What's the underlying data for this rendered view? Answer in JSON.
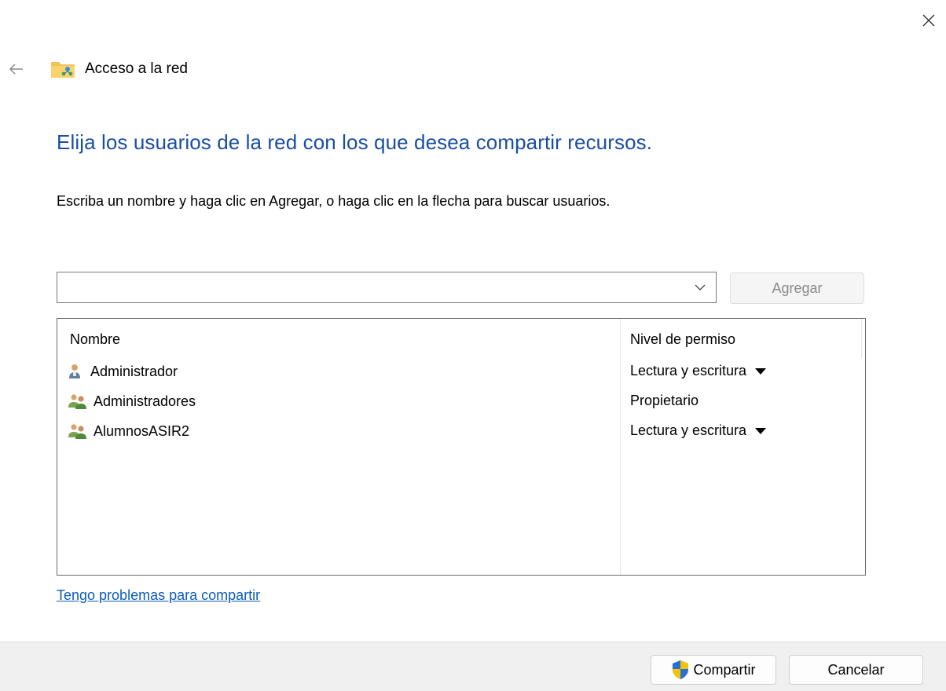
{
  "window": {
    "title": "Acceso a la red",
    "close_icon": "close-icon",
    "back_icon": "back-arrow-icon",
    "folder_icon": "network-folder-icon"
  },
  "main": {
    "heading": "Elija los usuarios de la red con los que desea compartir recursos.",
    "instruction": "Escriba un nombre y haga clic en Agregar, o haga clic en la flecha para buscar usuarios.",
    "name_input_value": "",
    "add_label": "Agregar",
    "columns": {
      "name": "Nombre",
      "permission": "Nivel de permiso"
    },
    "users": [
      {
        "name": "Administrador",
        "icon": "user-icon",
        "permission": "Lectura y escritura",
        "has_dropdown": true
      },
      {
        "name": "Administradores",
        "icon": "user-group-icon",
        "permission": "Propietario",
        "has_dropdown": false
      },
      {
        "name": "AlumnosASIR2",
        "icon": "user-group-icon",
        "permission": "Lectura y escritura",
        "has_dropdown": true
      }
    ],
    "help_link": "Tengo problemas para compartir"
  },
  "footer": {
    "share_label": "Compartir",
    "share_icon": "uac-shield-icon",
    "cancel_label": "Cancelar"
  },
  "colors": {
    "heading": "#1a4ea3",
    "link": "#0b5cbd",
    "footer_bg": "#f0f0f0"
  }
}
